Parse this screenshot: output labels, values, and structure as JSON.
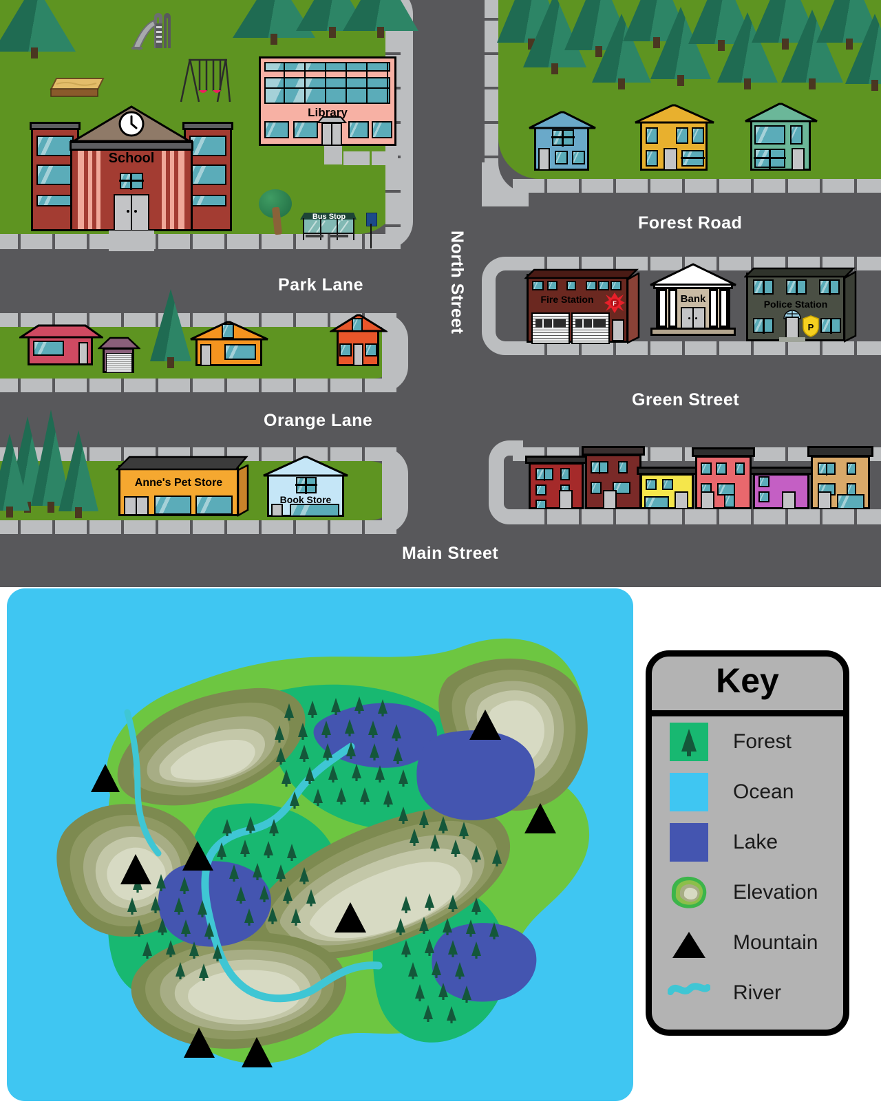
{
  "town_map": {
    "streets": [
      {
        "name": "Park Lane",
        "orientation": "horizontal"
      },
      {
        "name": "Orange Lane",
        "orientation": "horizontal"
      },
      {
        "name": "Main Street",
        "orientation": "horizontal"
      },
      {
        "name": "Forest Road",
        "orientation": "horizontal"
      },
      {
        "name": "Green Street",
        "orientation": "horizontal"
      },
      {
        "name": "North Street",
        "orientation": "vertical"
      }
    ],
    "buildings": [
      {
        "label": "School",
        "type": "school",
        "color": "#a33c32"
      },
      {
        "label": "Library",
        "type": "library",
        "color": "#f7b1a4"
      },
      {
        "label": "Bus Stop",
        "type": "bus-stop",
        "color": "#1d4437"
      },
      {
        "label": "Fire Station",
        "type": "fire-station",
        "color": "#6b2820"
      },
      {
        "label": "Bank",
        "type": "bank",
        "color": "#c9bba4"
      },
      {
        "label": "Police Station",
        "type": "police-station",
        "color": "#4a4f44"
      },
      {
        "label": "Anne's Pet Store",
        "type": "pet-store",
        "color": "#f5a830"
      },
      {
        "label": "Book Store",
        "type": "book-store",
        "color": "#c5e6f7"
      }
    ],
    "park_features": [
      "slide",
      "swing-set",
      "sandbox",
      "tree"
    ],
    "house_colors_park_lane": [
      "#cf4a62",
      "#f5941f",
      "#e8562a"
    ],
    "house_colors_forest_road": [
      "#6aa9c9",
      "#e8b02e",
      "#6bb799"
    ],
    "row_house_colors_green_street": [
      "#a52a2a",
      "#7a2a28",
      "#f5e64b",
      "#e8686d",
      "#c45fc4",
      "#d9a969"
    ],
    "colors": {
      "road": "#58585b",
      "sidewalk": "#bcbec0",
      "grass": "#5e9421",
      "street_label": "#ffffff"
    }
  },
  "island_map": {
    "colors": {
      "ocean": "#3fc6f2",
      "lowland": "#6dc641",
      "forest": "#18b871",
      "forest_tree": "#14573a",
      "lake": "#4455b0",
      "river": "#3fc6d4",
      "elevation_1": "#7d8a50",
      "elevation_2": "#8f9963",
      "elevation_3": "#a7ad85",
      "elevation_4": "#c3c7a8",
      "elevation_5": "#d7dac3",
      "mountain": "#000000"
    },
    "mountain_count": 8,
    "lake_count": 4,
    "feature_summary": "Island with forests, four lakes, a river, elevation contours and eight mountain peaks surrounded by ocean"
  },
  "key": {
    "title": "Key",
    "items": [
      {
        "label": "Forest",
        "icon": "forest-swatch",
        "color": "#18b871"
      },
      {
        "label": "Ocean",
        "icon": "ocean-swatch",
        "color": "#3fc6f2"
      },
      {
        "label": "Lake",
        "icon": "lake-swatch",
        "color": "#4455b0"
      },
      {
        "label": "Elevation",
        "icon": "elevation-swatch",
        "color": "#8f9963"
      },
      {
        "label": "Mountain",
        "icon": "mountain-triangle-icon",
        "color": "#000000"
      },
      {
        "label": "River",
        "icon": "river-squiggle-icon",
        "color": "#3fc6d4"
      }
    ]
  }
}
